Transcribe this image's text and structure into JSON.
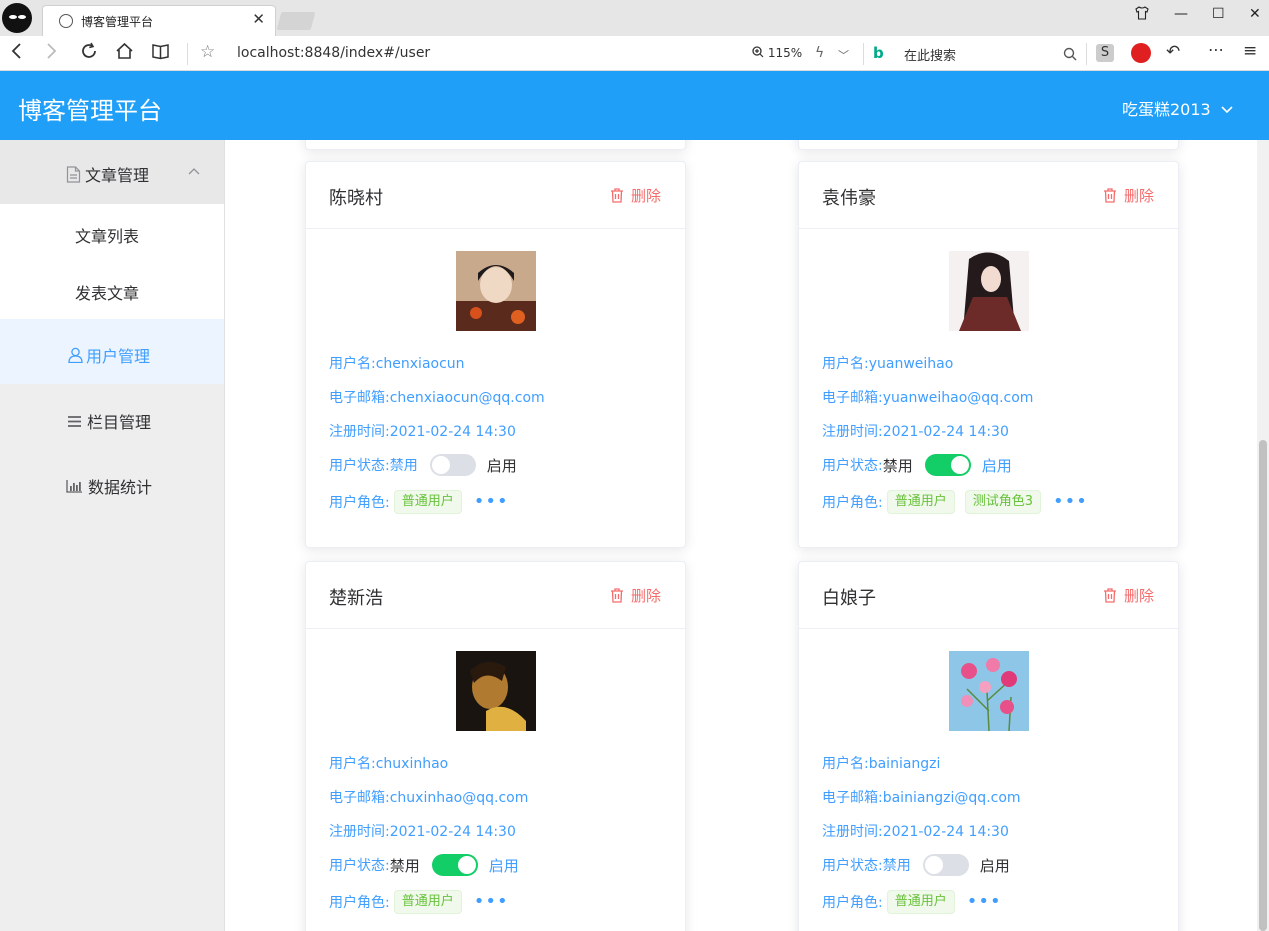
{
  "browser": {
    "tab_title": "博客管理平台",
    "address": "localhost:8848/index#/user",
    "zoom": "115%",
    "search_placeholder": "在此搜索"
  },
  "header": {
    "brand": "博客管理平台",
    "username": "吃蛋糕2013"
  },
  "sidebar": {
    "items": [
      {
        "label": "文章管理",
        "icon": "document-icon"
      },
      {
        "label": "文章列表"
      },
      {
        "label": "发表文章"
      },
      {
        "label": "用户管理",
        "icon": "user-icon"
      },
      {
        "label": "栏目管理",
        "icon": "list-icon"
      },
      {
        "label": "数据统计",
        "icon": "chart-icon"
      }
    ],
    "active_color": "#409eff"
  },
  "labels": {
    "delete": "删除",
    "username_prefix": "用户名:",
    "email_prefix": "电子邮箱:",
    "register_prefix": "注册时间:",
    "status_label": "用户状态:",
    "status_disabled": "禁用",
    "status_enabled": "启用",
    "role_label": "用户角色:"
  },
  "users": [
    {
      "name": "陈晓村",
      "username": "chenxiaocun",
      "email": "chenxiaocun@qq.com",
      "registered": "2021-02-24 14:30",
      "enabled": false,
      "roles": [
        "普通用户"
      ]
    },
    {
      "name": "袁伟豪",
      "username": "yuanweihao",
      "email": "yuanweihao@qq.com",
      "registered": "2021-02-24 14:30",
      "enabled": true,
      "roles": [
        "普通用户",
        "测试角色3"
      ]
    },
    {
      "name": "楚新浩",
      "username": "chuxinhao",
      "email": "chuxinhao@qq.com",
      "registered": "2021-02-24 14:30",
      "enabled": true,
      "roles": [
        "普通用户"
      ]
    },
    {
      "name": "白娘子",
      "username": "bainiangzi",
      "email": "bainiangzi@qq.com",
      "registered": "2021-02-24 14:30",
      "enabled": false,
      "roles": [
        "普通用户"
      ]
    }
  ],
  "colors": {
    "header_bg": "#1f9ff8",
    "link": "#409eff",
    "danger": "#f56c6c",
    "switch_on": "#13ce66",
    "tag_green": "#67c23a"
  }
}
